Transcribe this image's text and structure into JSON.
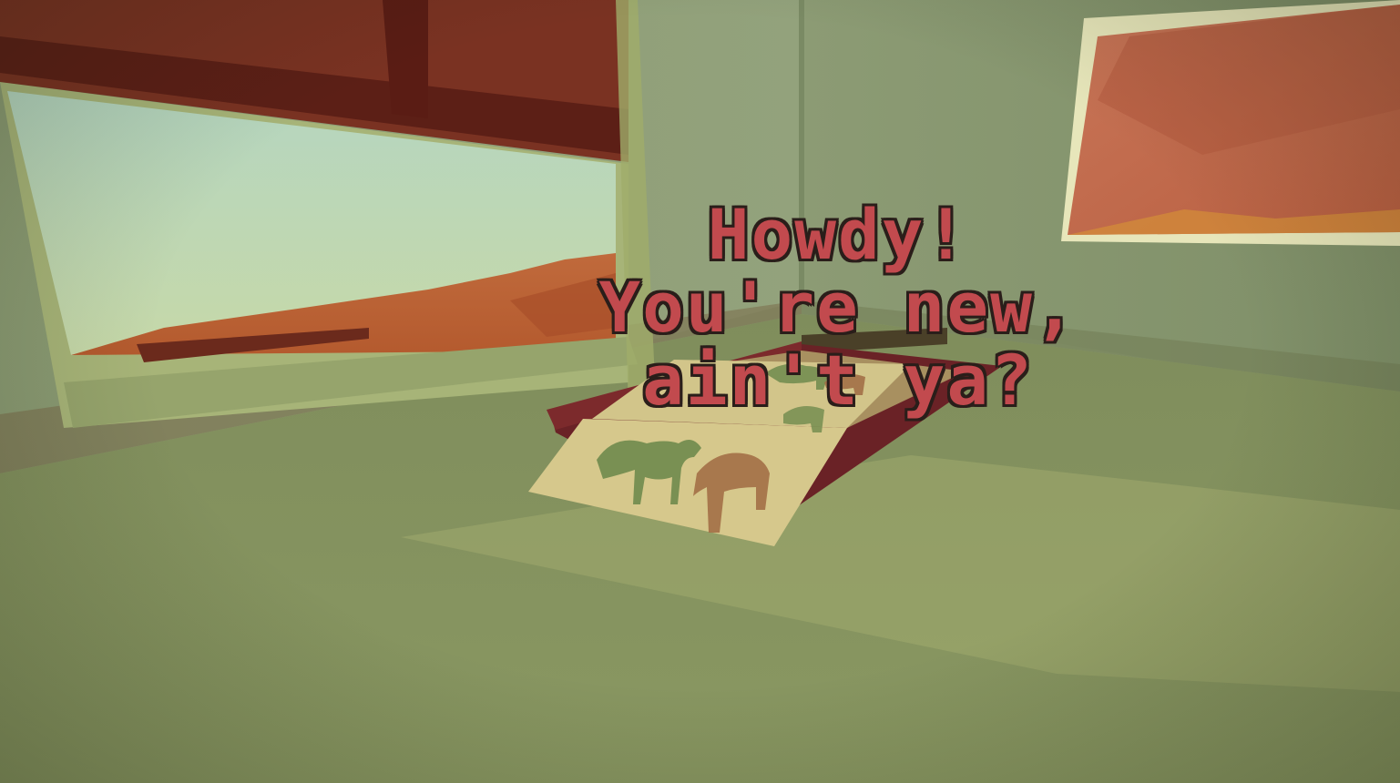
{
  "dialog": {
    "line1": "Howdy!",
    "line2": "You're new,",
    "line3": "ain't ya?"
  },
  "colors": {
    "dialog_text": "#c24a4e",
    "dialog_outline": "#2a1e1a",
    "wall": "#8e9c74",
    "floor": "#88965f",
    "window_frame": "#6a2a1e",
    "sky": "#b7d4b4",
    "dunes": "#c8683a",
    "blanket": "#d8cc90"
  },
  "scene": {
    "objects": [
      "window-left",
      "window-right",
      "bed",
      "horse-blanket",
      "floor",
      "walls"
    ]
  }
}
